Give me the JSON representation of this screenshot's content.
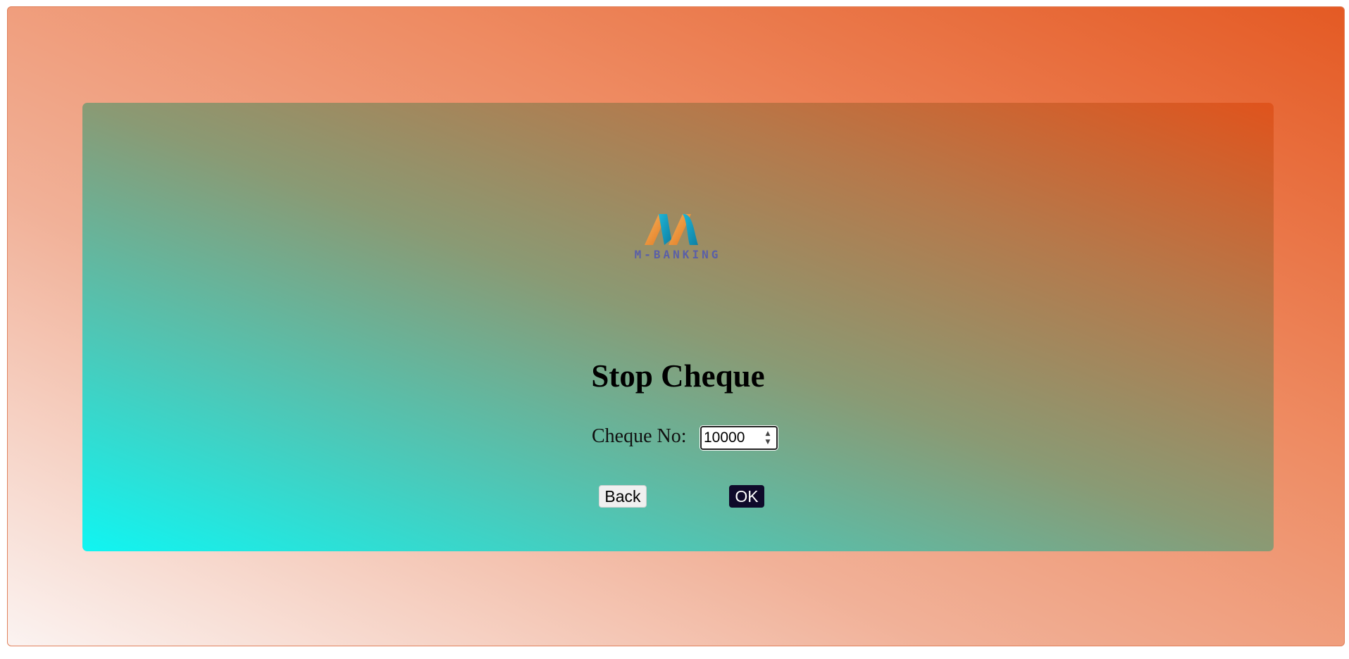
{
  "logo": {
    "text": "M-BANKING"
  },
  "page": {
    "title": "Stop Cheque"
  },
  "form": {
    "cheque_label": "Cheque No:",
    "cheque_value": "10000"
  },
  "buttons": {
    "back": "Back",
    "ok": "OK"
  },
  "colors": {
    "outer_gradient_end": "#e45a24",
    "card_gradient_start": "#10f5f2",
    "card_gradient_end": "#e0531c",
    "ok_button": "#0f0a2a"
  }
}
